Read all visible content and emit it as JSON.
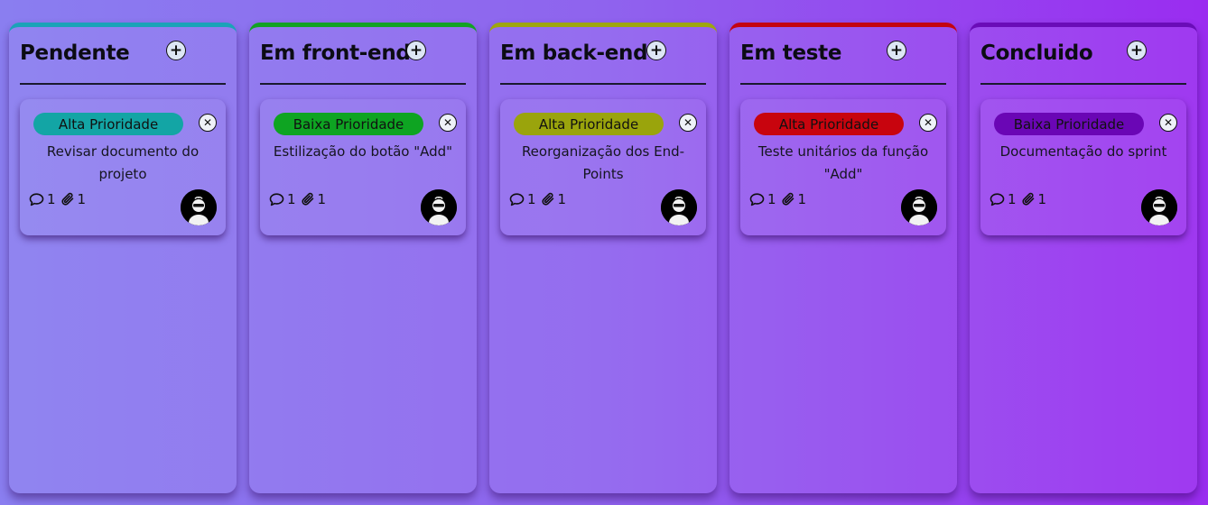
{
  "columns": [
    {
      "title": "Pendente",
      "accent": "#1aa3b8",
      "card": {
        "priority": "Alta Prioridade",
        "priority_color": "#13a5a5",
        "title": "Revisar documento do projeto",
        "comments": "1",
        "attachments": "1"
      }
    },
    {
      "title": "Em front-end",
      "accent": "#12a224",
      "card": {
        "priority": "Baixa Prioridade",
        "priority_color": "#0ea422",
        "title": "Estilização do botão \"Add\"",
        "comments": "1",
        "attachments": "1"
      }
    },
    {
      "title": "Em back-end",
      "accent": "#9ea60e",
      "card": {
        "priority": "Alta Prioridade",
        "priority_color": "#9aa40c",
        "title": "Reorganização dos End-Points",
        "comments": "1",
        "attachments": "1"
      }
    },
    {
      "title": "Em teste",
      "accent": "#c40410",
      "card": {
        "priority": "Alta Prioridade",
        "priority_color": "#c8040e",
        "title": "Teste unitários da função \"Add\"",
        "comments": "1",
        "attachments": "1"
      }
    },
    {
      "title": "Concluido",
      "accent": "#6a0cb8",
      "card": {
        "priority": "Baixa Prioridade",
        "priority_color": "#6a06b5",
        "title": "Documentação do sprint",
        "comments": "1",
        "attachments": "1"
      }
    }
  ],
  "icons": {
    "add": "plus-icon",
    "close": "close-icon",
    "comment": "comment-icon",
    "attachment": "paperclip-icon",
    "avatar": "user-avatar"
  }
}
